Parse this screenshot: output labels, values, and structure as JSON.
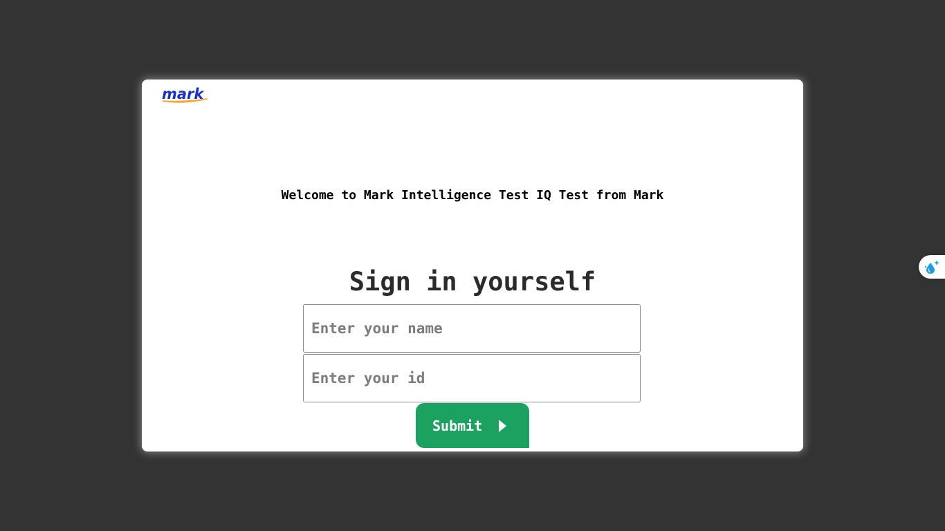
{
  "app": {
    "logo_text": "mark"
  },
  "welcome_text": "Welcome to Mark Intelligence Test IQ Test from Mark",
  "form": {
    "heading": "Sign in yourself",
    "name_placeholder": "Enter your name",
    "name_value": "",
    "id_placeholder": "Enter your id",
    "id_value": "",
    "submit_label": "Submit",
    "submit_icon": "caret-right-icon"
  },
  "extension": {
    "icon": "droplet-sparkle-icon"
  },
  "colors": {
    "background": "#333333",
    "card": "#ffffff",
    "logo_blue": "#1a2fd0",
    "logo_swoosh": "#f5a623",
    "submit_green": "#1ba261",
    "extension_blue": "#1a9be6"
  }
}
